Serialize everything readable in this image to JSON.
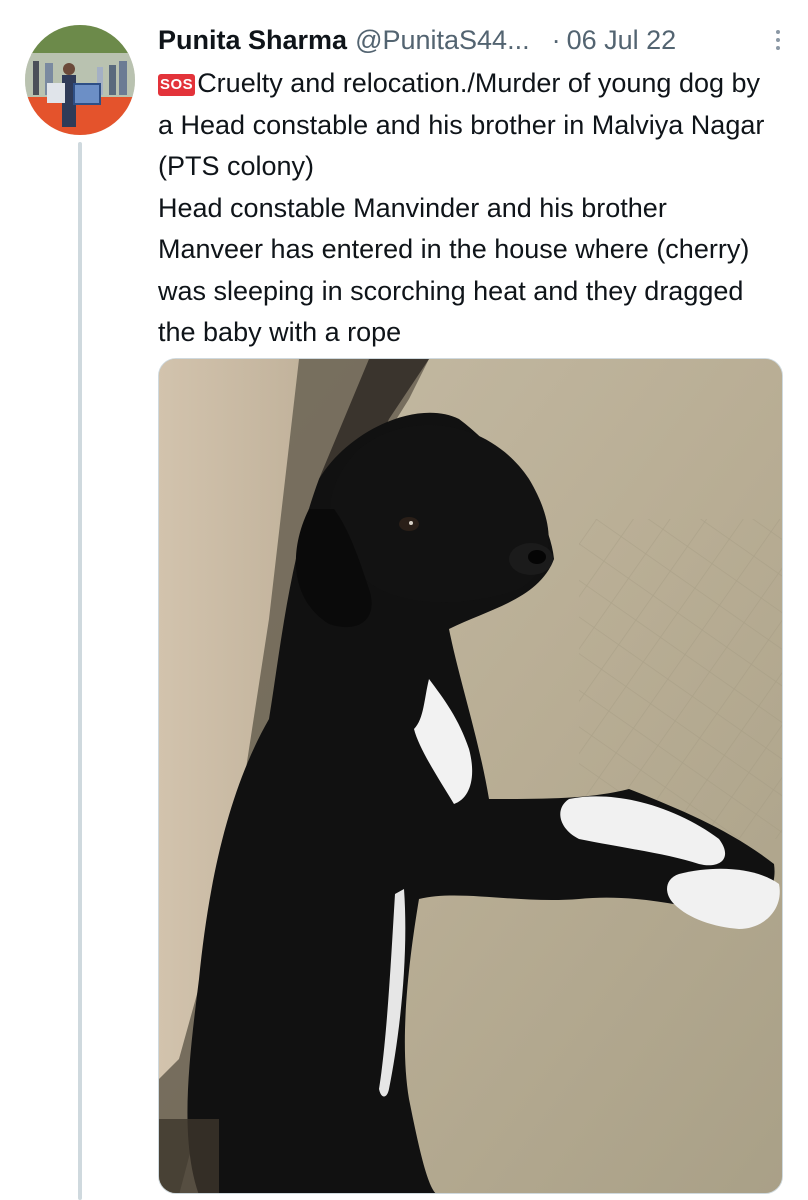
{
  "tweet": {
    "author_name": "Punita Sharma",
    "author_handle": "@PunitaS44...",
    "separator": "·",
    "date": "06 Jul 22",
    "sos_badge": "SOS",
    "lines": [
      "Cruelty and relocation./Murder of  young dog by a Head constable and his brother in Malviya Nagar (PTS colony)",
      "Head constable Manvinder and his brother Manveer has entered in the house where (cherry) was sleeping in scorching heat and they dragged the baby with a rope"
    ],
    "more_icon": "more-vertical-icon",
    "avatar_icon": "profile-photo",
    "media_icon": "photo-black-puppy-lying-on-floor"
  },
  "colors": {
    "text_primary": "#0f1419",
    "text_secondary": "#536471",
    "sos_red": "#e3333a",
    "thread_line": "#cfd9de"
  }
}
